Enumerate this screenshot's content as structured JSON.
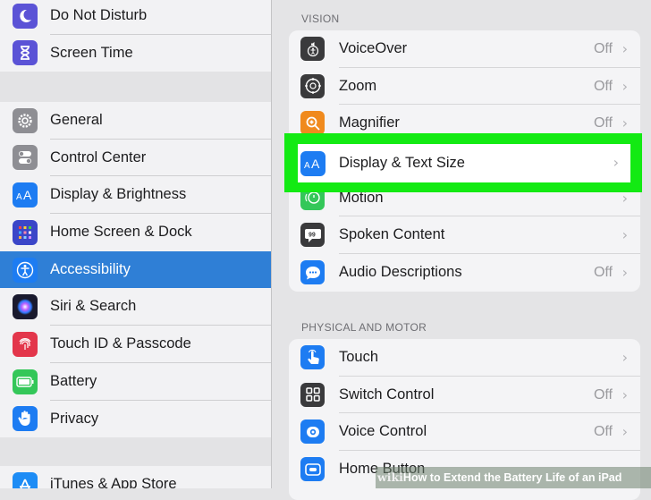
{
  "sidebar": {
    "group1": [
      {
        "label": "Do Not Disturb",
        "icon": "moon-icon",
        "color": "#5b53d6"
      },
      {
        "label": "Screen Time",
        "icon": "hourglass-icon",
        "color": "#5b53d6"
      }
    ],
    "group2": [
      {
        "label": "General",
        "icon": "gear-icon",
        "color": "#8e8e93"
      },
      {
        "label": "Control Center",
        "icon": "toggles-icon",
        "color": "#8e8e93"
      },
      {
        "label": "Display & Brightness",
        "icon": "text-size-icon",
        "color": "#1d7cf2"
      },
      {
        "label": "Home Screen & Dock",
        "icon": "app-grid-icon",
        "color": "#3b46c8"
      },
      {
        "label": "Accessibility",
        "icon": "accessibility-icon",
        "color": "#1d7cf2",
        "selected": true
      },
      {
        "label": "Siri & Search",
        "icon": "siri-icon",
        "color": "#1a1a2e"
      },
      {
        "label": "Touch ID & Passcode",
        "icon": "fingerprint-icon",
        "color": "#e3364b"
      },
      {
        "label": "Battery",
        "icon": "battery-icon",
        "color": "#34c759"
      },
      {
        "label": "Privacy",
        "icon": "hand-icon",
        "color": "#1d7cf2"
      }
    ],
    "group3": [
      {
        "label": "iTunes & App Store",
        "icon": "app-store-icon",
        "color": "#1d8cf5"
      }
    ]
  },
  "main": {
    "vision_title": "VISION",
    "vision": [
      {
        "label": "VoiceOver",
        "value": "Off",
        "icon": "voiceover-icon",
        "color": "#3a3a3c"
      },
      {
        "label": "Zoom",
        "value": "Off",
        "icon": "zoom-icon",
        "color": "#3a3a3c"
      },
      {
        "label": "Magnifier",
        "value": "Off",
        "icon": "magnifier-icon",
        "color": "#f08a1d"
      },
      {
        "label": "Display & Text Size",
        "value": "",
        "icon": "text-size-icon",
        "color": "#1d7cf2",
        "highlighted": true
      },
      {
        "label": "Motion",
        "value": "",
        "icon": "motion-icon",
        "color": "#34c759"
      },
      {
        "label": "Spoken Content",
        "value": "",
        "icon": "speech-bubble-icon",
        "color": "#3a3a3c"
      },
      {
        "label": "Audio Descriptions",
        "value": "Off",
        "icon": "audio-description-icon",
        "color": "#1d7cf2"
      }
    ],
    "motor_title": "PHYSICAL AND MOTOR",
    "motor": [
      {
        "label": "Touch",
        "value": "",
        "icon": "touch-hand-icon",
        "color": "#1d7cf2"
      },
      {
        "label": "Switch Control",
        "value": "Off",
        "icon": "switch-grid-icon",
        "color": "#3a3a3c"
      },
      {
        "label": "Voice Control",
        "value": "Off",
        "icon": "voice-control-icon",
        "color": "#1d7cf2"
      },
      {
        "label": "Home Button",
        "value": "",
        "icon": "home-button-icon",
        "color": "#1d7cf2"
      }
    ],
    "chevron": "›"
  },
  "watermark": {
    "brand": "wiki",
    "prefix": "How",
    "text": " to Extend the Battery Life of an iPad"
  }
}
